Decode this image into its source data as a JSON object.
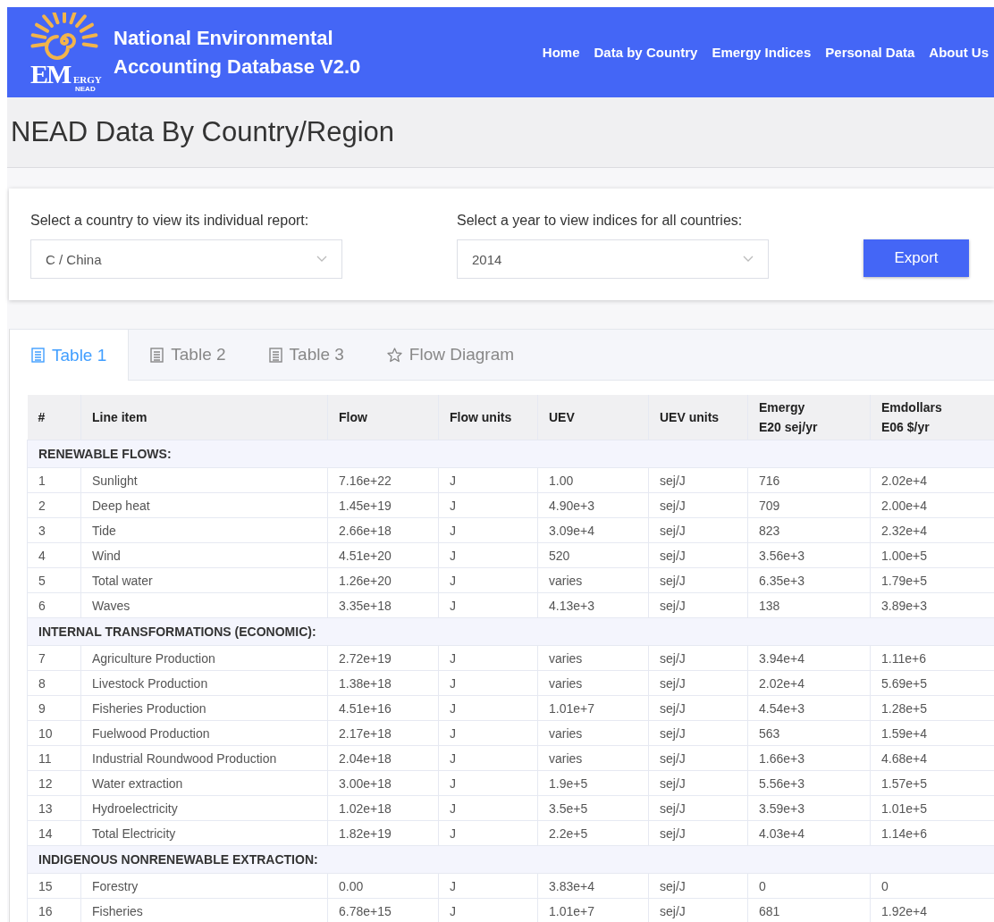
{
  "header": {
    "logo": {
      "mark": "EM",
      "word": "ERGY",
      "sub": "NEAD"
    },
    "title_lines": [
      "National Environmental",
      "Accounting Database V2.0"
    ],
    "nav": [
      {
        "label": "Home"
      },
      {
        "label": "Data by Country"
      },
      {
        "label": "Emergy Indices"
      },
      {
        "label": "Personal Data"
      },
      {
        "label": "About Us"
      }
    ]
  },
  "page_title": "NEAD Data By Country/Region",
  "filters": [
    {
      "label": "Select a country to view its individual report:",
      "value": "C / China"
    },
    {
      "label": "Select a year to view indices for all countries:",
      "value": "2014"
    }
  ],
  "export_button": "Export",
  "tabs": [
    {
      "label": "Table 1",
      "kind": "table",
      "selected": true
    },
    {
      "label": "Table 2",
      "kind": "table",
      "selected": false
    },
    {
      "label": "Table 3",
      "kind": "table",
      "selected": false
    },
    {
      "label": "Flow Diagram",
      "kind": "diagram",
      "selected": false
    }
  ],
  "table": {
    "columns": [
      [
        "#"
      ],
      [
        "Line item"
      ],
      [
        "Flow"
      ],
      [
        "Flow units"
      ],
      [
        "UEV"
      ],
      [
        "UEV units"
      ],
      [
        "Emergy",
        "E20 sej/yr"
      ],
      [
        "Emdollars",
        "E06 $/yr"
      ]
    ],
    "rows": [
      {
        "kind": "section",
        "label": "RENEWABLE FLOWS:"
      },
      {
        "kind": "item",
        "cells": [
          "1",
          "Sunlight",
          "7.16e+22",
          "J",
          "1.00",
          "sej/J",
          "716",
          "2.02e+4"
        ]
      },
      {
        "kind": "item",
        "cells": [
          "2",
          "Deep heat",
          "1.45e+19",
          "J",
          "4.90e+3",
          "sej/J",
          "709",
          "2.00e+4"
        ]
      },
      {
        "kind": "item",
        "cells": [
          "3",
          "Tide",
          "2.66e+18",
          "J",
          "3.09e+4",
          "sej/J",
          "823",
          "2.32e+4"
        ]
      },
      {
        "kind": "item",
        "cells": [
          "4",
          "Wind",
          "4.51e+20",
          "J",
          "520",
          "sej/J",
          "3.56e+3",
          "1.00e+5"
        ]
      },
      {
        "kind": "item",
        "cells": [
          "5",
          "Total water",
          "1.26e+20",
          "J",
          "varies",
          "sej/J",
          "6.35e+3",
          "1.79e+5"
        ]
      },
      {
        "kind": "item",
        "cells": [
          "6",
          "Waves",
          "3.35e+18",
          "J",
          "4.13e+3",
          "sej/J",
          "138",
          "3.89e+3"
        ]
      },
      {
        "kind": "section",
        "label": "INTERNAL TRANSFORMATIONS (ECONOMIC):"
      },
      {
        "kind": "item",
        "cells": [
          "7",
          "Agriculture Production",
          "2.72e+19",
          "J",
          "varies",
          "sej/J",
          "3.94e+4",
          "1.11e+6"
        ]
      },
      {
        "kind": "item",
        "cells": [
          "8",
          "Livestock Production",
          "1.38e+18",
          "J",
          "varies",
          "sej/J",
          "2.02e+4",
          "5.69e+5"
        ]
      },
      {
        "kind": "item",
        "cells": [
          "9",
          "Fisheries Production",
          "4.51e+16",
          "J",
          "1.01e+7",
          "sej/J",
          "4.54e+3",
          "1.28e+5"
        ]
      },
      {
        "kind": "item",
        "cells": [
          "10",
          "Fuelwood Production",
          "2.17e+18",
          "J",
          "varies",
          "sej/J",
          "563",
          "1.59e+4"
        ]
      },
      {
        "kind": "item",
        "cells": [
          "11",
          "Industrial Roundwood Production",
          "2.04e+18",
          "J",
          "varies",
          "sej/J",
          "1.66e+3",
          "4.68e+4"
        ]
      },
      {
        "kind": "item",
        "cells": [
          "12",
          "Water extraction",
          "3.00e+18",
          "J",
          "1.9e+5",
          "sej/J",
          "5.56e+3",
          "1.57e+5"
        ]
      },
      {
        "kind": "item",
        "cells": [
          "13",
          "Hydroelectricity",
          "1.02e+18",
          "J",
          "3.5e+5",
          "sej/J",
          "3.59e+3",
          "1.01e+5"
        ]
      },
      {
        "kind": "item",
        "cells": [
          "14",
          "Total Electricity",
          "1.82e+19",
          "J",
          "2.2e+5",
          "sej/J",
          "4.03e+4",
          "1.14e+6"
        ]
      },
      {
        "kind": "section",
        "label": "INDIGENOUS NONRENEWABLE EXTRACTION:"
      },
      {
        "kind": "item",
        "cells": [
          "15",
          "Forestry",
          "0.00",
          "J",
          "3.83e+4",
          "sej/J",
          "0",
          "0"
        ]
      },
      {
        "kind": "item",
        "cells": [
          "16",
          "Fisheries",
          "6.78e+15",
          "J",
          "1.01e+7",
          "sej/J",
          "681",
          "1.92e+4"
        ]
      }
    ]
  }
}
